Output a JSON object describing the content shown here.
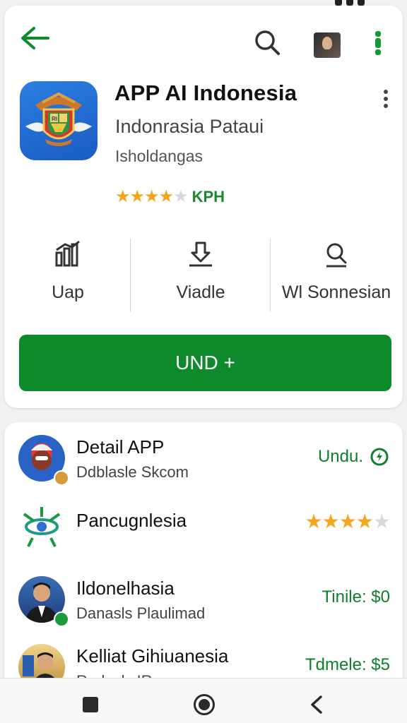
{
  "header": {
    "back_icon": "arrow-left-icon",
    "search_icon": "search-icon",
    "more_icon": "more-vertical-icon"
  },
  "app": {
    "title": "APP AI Indonesia",
    "subtitle": "Indonrasia Pataui",
    "developer": "Isholdangas",
    "rating_stars": 3.5,
    "rating_label": "KPH"
  },
  "stats": [
    {
      "icon": "chart-icon",
      "label": "Uap"
    },
    {
      "icon": "download-icon",
      "label": "Viadle"
    },
    {
      "icon": "user-search-icon",
      "label": "Wl Sonnesian"
    }
  ],
  "install_button": {
    "label": "UND +"
  },
  "list": [
    {
      "title": "Detail APP",
      "subtitle": "Ddblasle Skcom",
      "right_text": "Undu.",
      "right_icon": "update-icon"
    },
    {
      "title": "Pancugnlesia",
      "subtitle": "",
      "rating": 3.5
    },
    {
      "title": "Ildonelhasia",
      "subtitle": "Danasls Plaulimad",
      "right_text": "Tinile: $0"
    },
    {
      "title": "Kelliat Gihiuanesia",
      "subtitle": "Rodasls IRa",
      "right_text": "Tdmele: $5"
    }
  ],
  "colors": {
    "accent": "#0d8a2b",
    "star": "#f4a51c",
    "app_icon_bg": "#2b7fe0"
  },
  "navbar": {
    "recents_icon": "square-icon",
    "home_icon": "home-circle-icon",
    "back_icon": "chevron-left-icon"
  }
}
